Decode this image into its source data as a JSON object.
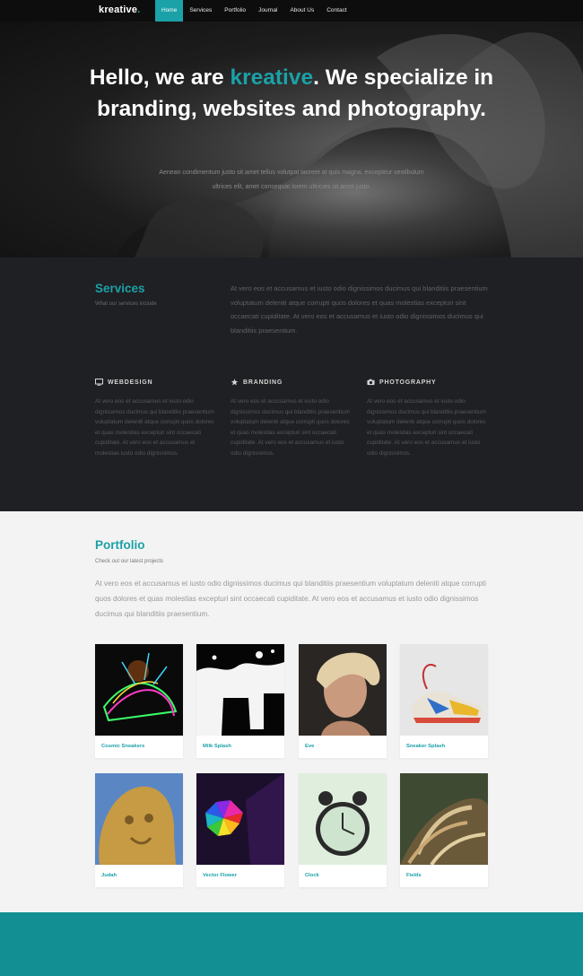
{
  "nav": {
    "logo": "kreative",
    "logo_dot": ".",
    "items": [
      {
        "label": "Home",
        "active": true
      },
      {
        "label": "Services"
      },
      {
        "label": "Portfolio"
      },
      {
        "label": "Journal"
      },
      {
        "label": "About Us"
      },
      {
        "label": "Contact"
      }
    ]
  },
  "hero": {
    "title_pre": "Hello, we are ",
    "title_accent": "kreative",
    "title_post": ". We specialize in branding, websites and photography.",
    "subtitle": "Aenean condimentum justo sit amet tellus volutpat laoreet at quis magna, excepteur vestibulum ultrices elit, amet consequat lorem ultricies sit amet justo."
  },
  "services": {
    "title": "Services",
    "subtitle": "What our services include",
    "intro": "At vero eos et accusamus et iusto odio dignissimos ducimus qui blanditiis praesentium voluptatum deleniti atque corrupti quos dolores et quas molestias excepturi sint occaecati cupiditate. At vero eos et accusamus et iusto odio dignissimos ducimus qui blanditiis praesentium.",
    "columns": [
      {
        "icon": "monitor-icon",
        "title": "WEBDESIGN",
        "text": "At vero eos et accusamus et iusto odio dignissimos ducimus qui blanditiis praesentium voluptatum deleniti atque corrupti quos dolores et quas molestias excepturi sint occaecati cupiditate. At vero eos et accusamus et molestias iusto odio dignissimos."
      },
      {
        "icon": "star-icon",
        "title": "BRANDING",
        "text": "At vero eos et accusamus et iusto odio dignissimos ducimus qui blanditiis praesentium voluptatum deleniti atque corrupti quos dolores et quas molestias excepturi sint occaecati cupiditate. At vero eos et accusamus et iusto odio dignissimos."
      },
      {
        "icon": "camera-icon",
        "title": "PHOTOGRAPHY",
        "text": "At vero eos et accusamus et iusto odio dignissimos ducimus qui blanditiis praesentium voluptatum deleniti atque corrupti quos dolores et quas molestias excepturi sint occaecati cupiditate. At vero eos et accusamus et iusto odio dignissimos."
      }
    ]
  },
  "portfolio": {
    "title": "Portfolio",
    "subtitle": "Check out our latest projects",
    "intro": "At vero eos et accusamus et iusto odio dignissimos ducimus qui blanditiis praesentium voluptatum deleniti atque corrupti quos dolores et quas molestias excepturi sint occaecati cupiditate. At vero eos et accusamus et iusto odio dignissimos ducimus qui blanditiis praesentium.",
    "items": [
      {
        "label": "Cosmic Sneakers"
      },
      {
        "label": "Milk Splash"
      },
      {
        "label": "Eve"
      },
      {
        "label": "Sneaker Splash"
      },
      {
        "label": "Judah"
      },
      {
        "label": "Vector Flower"
      },
      {
        "label": "Clock"
      },
      {
        "label": "Fields"
      }
    ]
  },
  "colors": {
    "accent": "#1ba1a8",
    "footer": "#118f93",
    "dark": "#1f2023"
  }
}
